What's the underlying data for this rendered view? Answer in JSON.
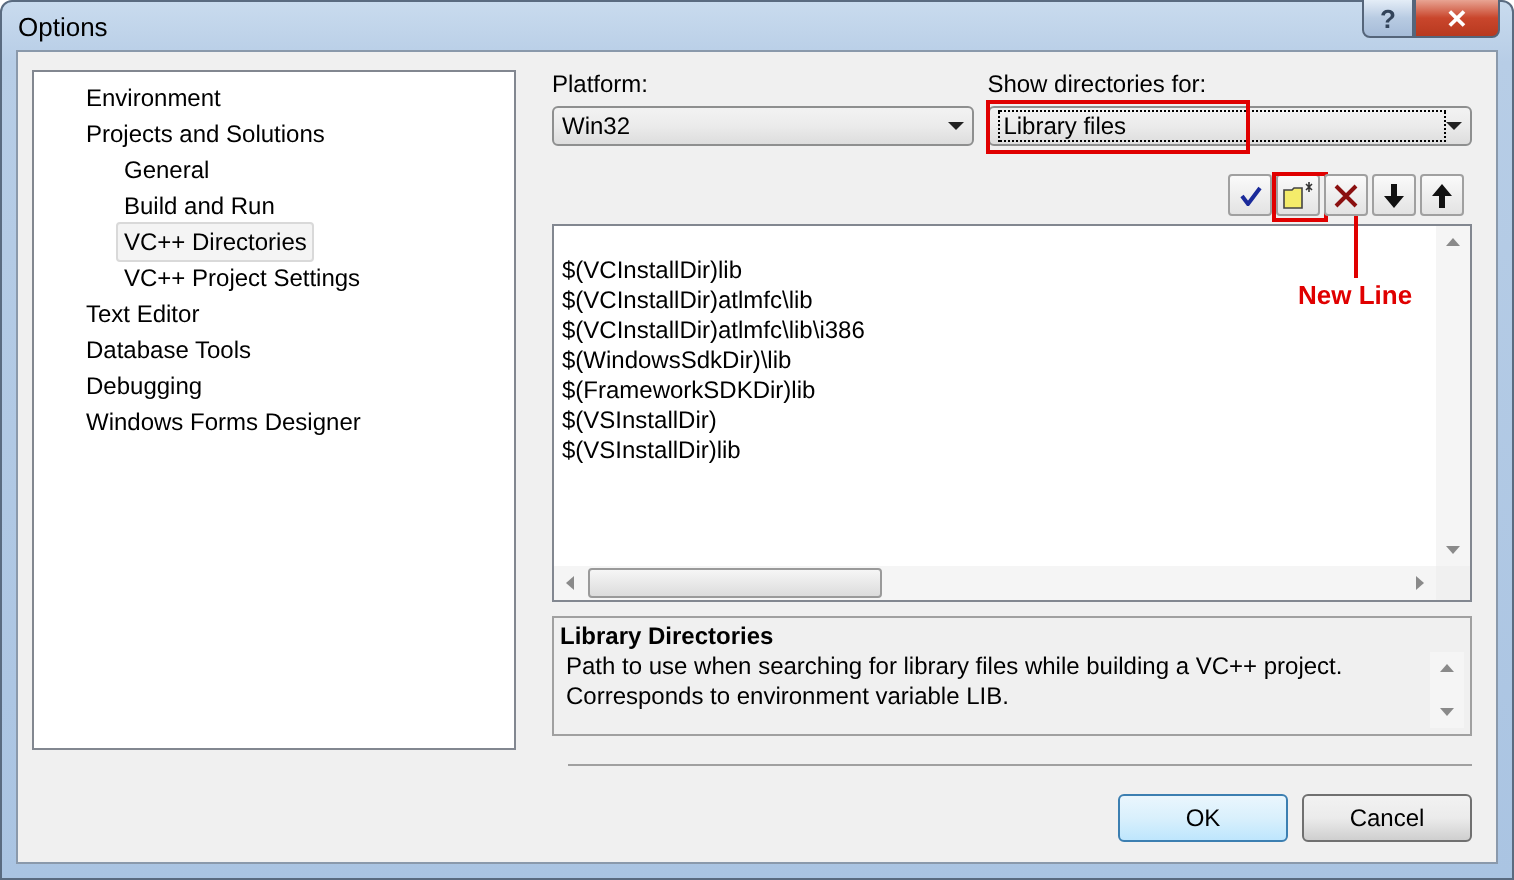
{
  "window": {
    "title": "Options",
    "controls": [
      {
        "kind": "help",
        "label": "?"
      },
      {
        "kind": "close",
        "label": "✕"
      }
    ]
  },
  "tree": [
    {
      "label": "Environment",
      "selected": false
    },
    {
      "label": "Projects and Solutions",
      "selected": false,
      "children": [
        {
          "label": "General",
          "selected": false
        },
        {
          "label": "Build and Run",
          "selected": false
        },
        {
          "label": "VC++ Directories",
          "selected": true
        },
        {
          "label": "VC++ Project Settings",
          "selected": false
        }
      ]
    },
    {
      "label": "Text Editor",
      "selected": false
    },
    {
      "label": "Database Tools",
      "selected": false
    },
    {
      "label": "Debugging",
      "selected": false
    },
    {
      "label": "Windows Forms Designer",
      "selected": false
    }
  ],
  "platform": {
    "label": "Platform:",
    "value": "Win32"
  },
  "show_directories": {
    "label": "Show directories for:",
    "value": "Library files",
    "highlighted": true
  },
  "toolbar": [
    {
      "kind": "check",
      "highlighted": false
    },
    {
      "kind": "new-folder",
      "highlighted": true
    },
    {
      "kind": "delete",
      "highlighted": false
    },
    {
      "kind": "down",
      "highlighted": false
    },
    {
      "kind": "up",
      "highlighted": false
    }
  ],
  "annotation": {
    "label": "New Line"
  },
  "directories": [
    "$(VCInstallDir)lib",
    "$(VCInstallDir)atlmfc\\lib",
    "$(VCInstallDir)atlmfc\\lib\\i386",
    "$(WindowsSdkDir)\\lib",
    "$(FrameworkSDKDir)lib",
    "$(VSInstallDir)",
    "$(VSInstallDir)lib"
  ],
  "description": {
    "title": "Library Directories",
    "text": "Path to use when searching for library files while building a VC++ project. Corresponds to environment variable LIB."
  },
  "buttons": [
    {
      "label": "OK",
      "default": true
    },
    {
      "label": "Cancel",
      "default": false
    }
  ]
}
